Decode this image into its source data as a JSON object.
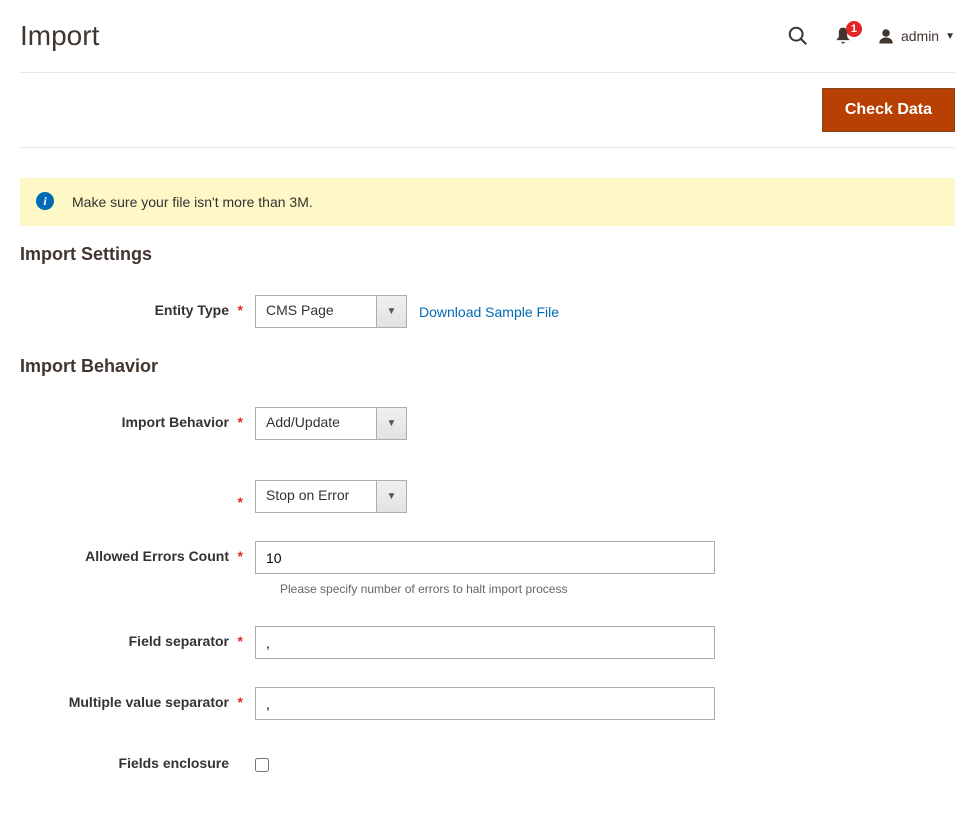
{
  "header": {
    "title": "Import",
    "username": "admin",
    "notification_count": "1"
  },
  "toolbar": {
    "check_data_label": "Check Data"
  },
  "message": {
    "text": "Make sure your file isn't more than 3M."
  },
  "sections": {
    "import_settings_title": "Import Settings",
    "import_behavior_title": "Import Behavior"
  },
  "fields": {
    "entity_type": {
      "label": "Entity Type",
      "value": "CMS Page",
      "sample_link": "Download Sample File"
    },
    "import_behavior": {
      "label": "Import Behavior",
      "value": "Add/Update"
    },
    "validation_strategy": {
      "value": "Stop on Error"
    },
    "allowed_errors": {
      "label": "Allowed Errors Count",
      "value": "10",
      "help": "Please specify number of errors to halt import process"
    },
    "field_separator": {
      "label": "Field separator",
      "value": ","
    },
    "multiple_value_separator": {
      "label": "Multiple value separator",
      "value": ","
    },
    "fields_enclosure": {
      "label": "Fields enclosure"
    }
  }
}
